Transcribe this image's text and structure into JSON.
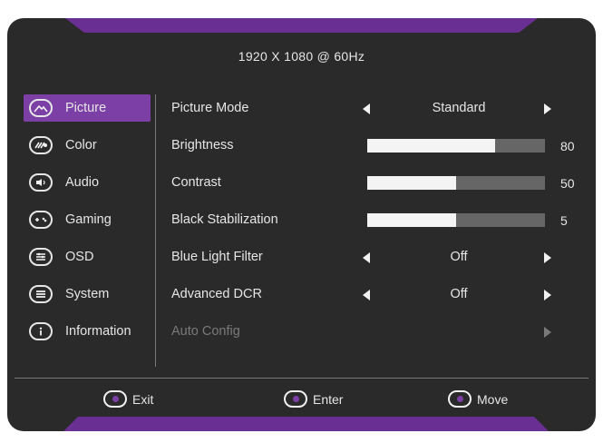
{
  "header": {
    "resolution": "1920 X 1080 @ 60Hz"
  },
  "sidebar": {
    "items": [
      {
        "label": "Picture",
        "icon": "mountain-icon",
        "active": true
      },
      {
        "label": "Color",
        "icon": "color-icon",
        "active": false
      },
      {
        "label": "Audio",
        "icon": "speaker-icon",
        "active": false
      },
      {
        "label": "Gaming",
        "icon": "gamepad-icon",
        "active": false
      },
      {
        "label": "OSD",
        "icon": "osd-icon",
        "active": false
      },
      {
        "label": "System",
        "icon": "system-icon",
        "active": false
      },
      {
        "label": "Information",
        "icon": "info-icon",
        "active": false
      }
    ]
  },
  "settings": {
    "picture_mode": {
      "label": "Picture Mode",
      "value": "Standard"
    },
    "brightness": {
      "label": "Brightness",
      "value": "80",
      "level": 0.72
    },
    "contrast": {
      "label": "Contrast",
      "value": "50",
      "level": 0.5
    },
    "black_stabilization": {
      "label": "Black Stabilization",
      "value": "5",
      "level": 0.5
    },
    "blue_light_filter": {
      "label": "Blue Light Filter",
      "value": "Off"
    },
    "advanced_dcr": {
      "label": "Advanced DCR",
      "value": "Off"
    },
    "auto_config": {
      "label": "Auto Config",
      "enabled": false
    }
  },
  "footer": {
    "exit": "Exit",
    "enter": "Enter",
    "move": "Move"
  },
  "colors": {
    "accent": "#7b3fa6",
    "panel": "#2a2a2a",
    "bar_track": "#666666",
    "bar_fill": "#f4f4f4"
  }
}
